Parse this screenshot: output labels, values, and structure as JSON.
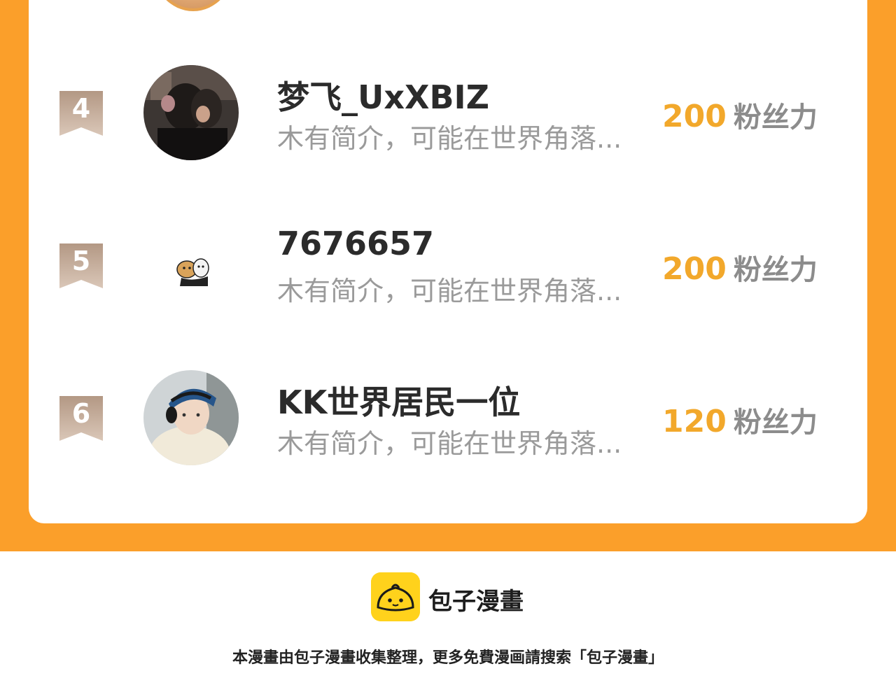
{
  "list": {
    "items": [
      {
        "rank": "4",
        "name": "梦飞_UxXBIZ",
        "desc": "木有简介，可能在世界角落...",
        "fans": "200",
        "fans_unit": "粉丝力",
        "avatar_icon": "couple-photo-avatar"
      },
      {
        "rank": "5",
        "name": "7676657",
        "desc": "木有简介，可能在世界角落...",
        "fans": "200",
        "fans_unit": "粉丝力",
        "avatar_icon": "cartoon-sticker-avatar"
      },
      {
        "rank": "6",
        "name": "KK世界居民一位",
        "desc": "木有简介，可能在世界角落...",
        "fans": "120",
        "fans_unit": "粉丝力",
        "avatar_icon": "headphones-boy-avatar"
      }
    ]
  },
  "footer": {
    "brand": "包子漫畫",
    "note": "本漫畫由包子漫畫收集整理，更多免費漫画請搜索「包子漫畫」",
    "logo_icon": "baozi-bun-logo-icon"
  },
  "colors": {
    "frame_orange": "#fb9f2a",
    "fans_number": "#f2a82b",
    "rank_badge": "#c9ab95",
    "logo_yellow": "#ffd21c"
  }
}
